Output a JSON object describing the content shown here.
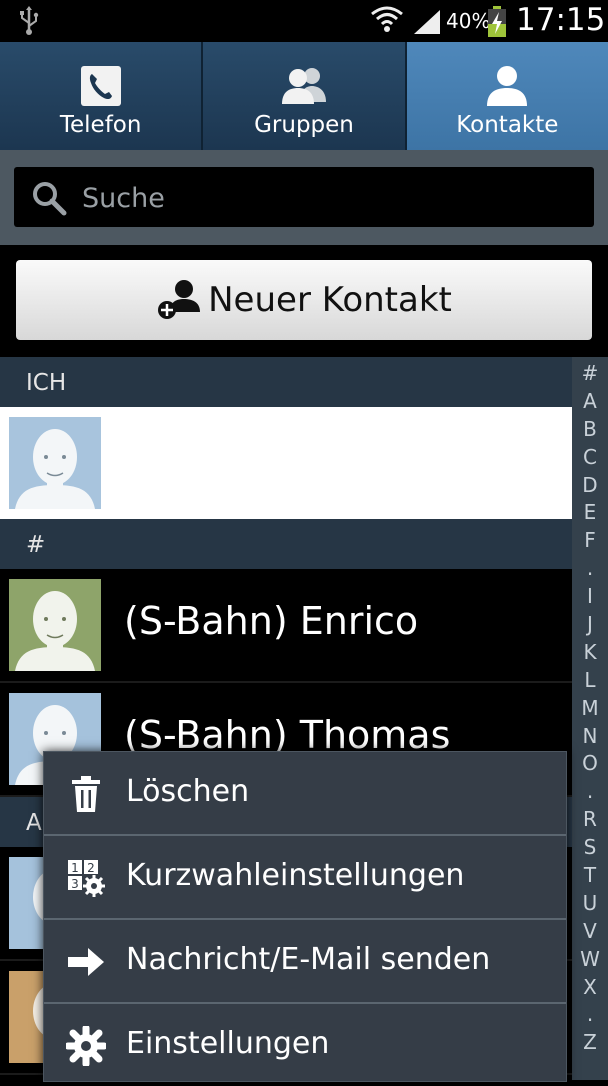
{
  "status_bar": {
    "battery": "40%",
    "time": "17:15"
  },
  "tabs": [
    {
      "label": "Telefon",
      "icon": "phone-icon",
      "active": false
    },
    {
      "label": "Gruppen",
      "icon": "group-icon",
      "active": false
    },
    {
      "label": "Kontakte",
      "icon": "contact-icon",
      "active": true
    }
  ],
  "search": {
    "placeholder": "Suche",
    "value": ""
  },
  "new_contact": {
    "label": "Neuer Kontakt"
  },
  "list": {
    "me_header": "ICH",
    "hash_header": "#",
    "a_header": "A",
    "contacts": [
      {
        "name": "(S-Bahn) Enrico",
        "avatar_color": "#8ea46a"
      },
      {
        "name": "(S-Bahn) Thomas",
        "avatar_color": "#a5c2dc"
      }
    ]
  },
  "index_letters": [
    "#",
    "A",
    "B",
    "C",
    "D",
    "E",
    "F",
    ".",
    "I",
    "J",
    "K",
    "L",
    "M",
    "N",
    "O",
    ".",
    "R",
    "S",
    "T",
    "U",
    "V",
    "W",
    "X",
    ".",
    "Z"
  ],
  "context_menu": {
    "items": [
      {
        "label": "Löschen",
        "icon": "trash-icon"
      },
      {
        "label": "Kurzwahleinstellungen",
        "icon": "speed-dial-settings-icon"
      },
      {
        "label": "Nachricht/E-Mail senden",
        "icon": "arrow-right-icon"
      },
      {
        "label": "Einstellungen",
        "icon": "gear-icon"
      }
    ]
  },
  "colors": {
    "tab_active": "#3f78aa",
    "section_header": "#263645",
    "menu_background": "#353d47"
  }
}
